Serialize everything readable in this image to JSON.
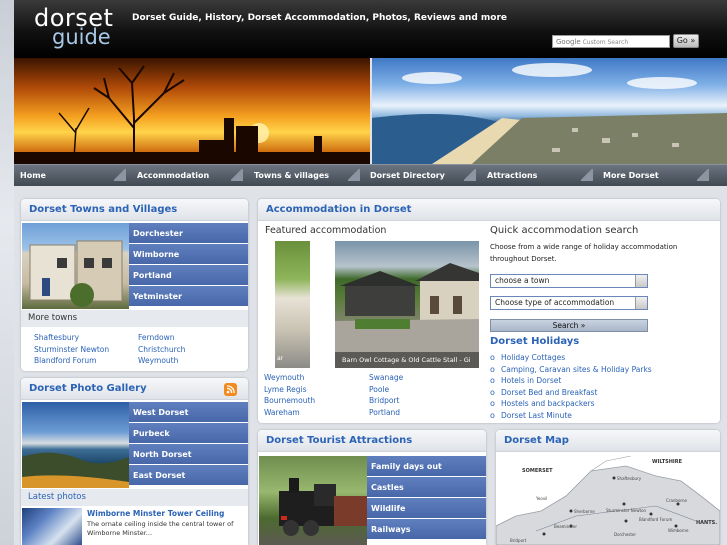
{
  "header": {
    "logo_top": "dorset",
    "logo_bottom": "guide",
    "tagline": "Dorset Guide, History, Dorset Accommodation, Photos, Reviews and more",
    "search_brand": "Google",
    "search_placeholder": "Custom Search",
    "search_go": "Go »"
  },
  "nav": [
    "Home",
    "Accommodation",
    "Towns & villages",
    "Dorset Directory",
    "Attractions",
    "More Dorset"
  ],
  "towns": {
    "title": "Dorset Towns and Villages",
    "featured": [
      "Dorchester",
      "Wimborne",
      "Portland",
      "Yetminster"
    ],
    "more_title": "More towns",
    "more_col1": [
      "Shaftesbury",
      "Sturminster Newton",
      "Blandford Forum"
    ],
    "more_col2": [
      "Ferndown",
      "Christchurch",
      "Weymouth"
    ]
  },
  "gallery": {
    "title": "Dorset Photo Gallery",
    "areas": [
      "West Dorset",
      "Purbeck",
      "North Dorset",
      "East Dorset"
    ],
    "latest_title": "Latest photos",
    "latest_caption": "Wimborne Minster Tower Ceiling",
    "latest_desc_1": "The ornate ceiling inside the central tower of",
    "latest_desc_2": "Wimborne Minster..."
  },
  "accommodation": {
    "title": "Accommodation in Dorset",
    "featured_title": "Featured accommodation",
    "thumb_caption": "ar",
    "photo_caption": "Barn Owl Cottage & Old Cattle Stall - Gi",
    "towns_col1": [
      "Weymouth",
      "Lyme Regis",
      "Bournemouth",
      "Wareham"
    ],
    "towns_col2": [
      "Swanage",
      "Poole",
      "Bridport",
      "Portland"
    ],
    "quick_title": "Quick accommodation search",
    "quick_desc_1": "Choose from a wide range of holiday accommodation",
    "quick_desc_2": "throughout Dorset.",
    "select_town": "choose a town",
    "select_type": "Choose type of accommodation",
    "search_button": "Search »",
    "holidays_title": "Dorset Holidays",
    "holidays": [
      "Holiday Cottages",
      "Camping, Caravan sites & Holiday Parks",
      "Hotels in Dorset",
      "Dorset Bed and Breakfast",
      "Hostels and backpackers",
      "Dorset Last Minute"
    ]
  },
  "attractions": {
    "title": "Dorset Tourist Attractions",
    "items": [
      "Family days out",
      "Castles",
      "Wildlife",
      "Railways"
    ]
  },
  "map": {
    "title": "Dorset Map",
    "regions": [
      "SOMERSET",
      "WILTSHIRE",
      "HANTS."
    ],
    "places": [
      "Shaftesbury",
      "Sherborne",
      "Sturminster Newton",
      "Blandford Forum",
      "Cranborne",
      "Wimborne",
      "Yeovil",
      "Beaminster",
      "Bridport",
      "Dorchester"
    ]
  }
}
